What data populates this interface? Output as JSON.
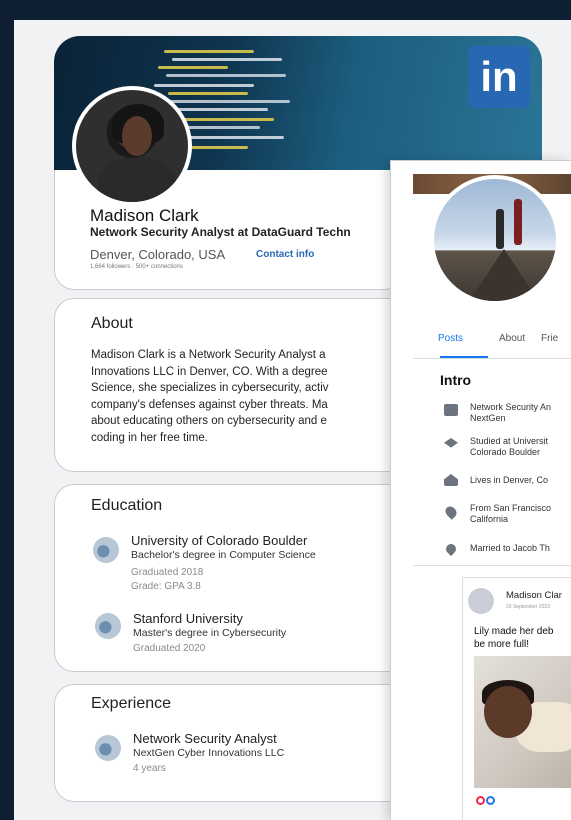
{
  "linkedin": {
    "logo": "in",
    "name": "Madison Clark",
    "headline": "Network Security Analyst at DataGuard Techn",
    "location": "Denver, Colorado, USA",
    "contact_info": "Contact info",
    "followers": "1,664 followers · 500+ connections",
    "about": {
      "title": "About",
      "text": "Madison Clark is a Network Security Analyst a\nInnovations LLC in Denver, CO. With a degree\nScience, she specializes in cybersecurity, activ\ncompany's defenses against cyber threats. Ma\nabout educating others on cybersecurity and e\ncoding in her free time."
    },
    "education": {
      "title": "Education",
      "entries": [
        {
          "school": "University of Colorado Boulder",
          "degree": "Bachelor's degree in Computer Science",
          "meta1": "Graduated 2018",
          "meta2": "Grade: GPA 3.8"
        },
        {
          "school": "Stanford University",
          "degree": "Master's degree in Cybersecurity",
          "meta1": "Graduated 2020"
        }
      ]
    },
    "experience": {
      "title": "Experience",
      "entries": [
        {
          "role": "Network Security Analyst",
          "company": "NextGen Cyber Innovations LLC",
          "duration": "4 years"
        }
      ]
    }
  },
  "facebook": {
    "tabs": [
      "Posts",
      "About",
      "Frie"
    ],
    "intro_title": "Intro",
    "intro_items": [
      {
        "icon": "briefcase-icon",
        "text": "Network Security An\nNextGen"
      },
      {
        "icon": "graduation-cap-icon",
        "text": "Studied at Universit\nColorado Boulder"
      },
      {
        "icon": "home-icon",
        "text": "Lives in Denver, Co"
      },
      {
        "icon": "location-pin-icon",
        "text": "From San Francisco\nCalifornia"
      },
      {
        "icon": "heart-icon",
        "text": "Married to Jacob Th"
      }
    ],
    "post": {
      "author": "Madison Clar",
      "date": "20 September 2023",
      "text": "Lily made her deb\nbe more full!",
      "reaction_colors": [
        "#f02849",
        "#1877f2"
      ]
    }
  },
  "colors": {
    "linkedin_blue": "#2867b2",
    "facebook_blue": "#1877f2",
    "background": "#0f1f33"
  }
}
